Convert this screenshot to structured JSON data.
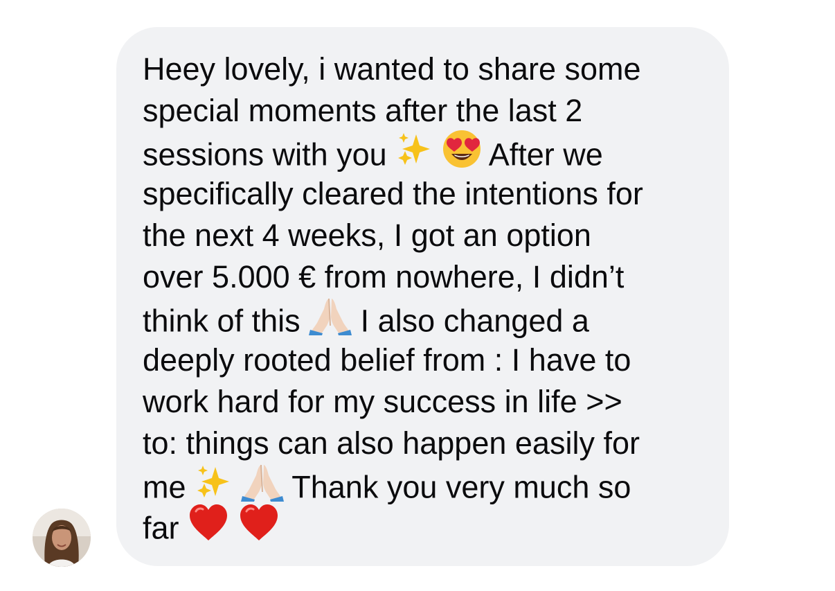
{
  "message": {
    "lines": [
      "Heey lovely, i wanted to share some",
      "special moments after the last 2",
      "sessions with you",
      "After we",
      "specifically cleared the intentions for",
      "the next 4 weeks, I got an option",
      "over 5.000 € from nowhere, I didn’t",
      "think of this",
      "I also changed a",
      "deeply rooted belief from : I have to",
      "work hard for my success in life >>",
      "to: things can also happen easily for",
      "me",
      "Thank you very much so",
      "far"
    ]
  },
  "icons": {
    "sparkles": "sparkles-icon",
    "heart_eyes": "heart-eyes-icon",
    "folded_hands": "folded-hands-icon",
    "red_heart": "red-heart-icon"
  },
  "colors": {
    "bubble_bg": "#f1f2f4",
    "text": "#0b0b0d",
    "heart": "#e0201b",
    "sparkle": "#f7c21a"
  }
}
